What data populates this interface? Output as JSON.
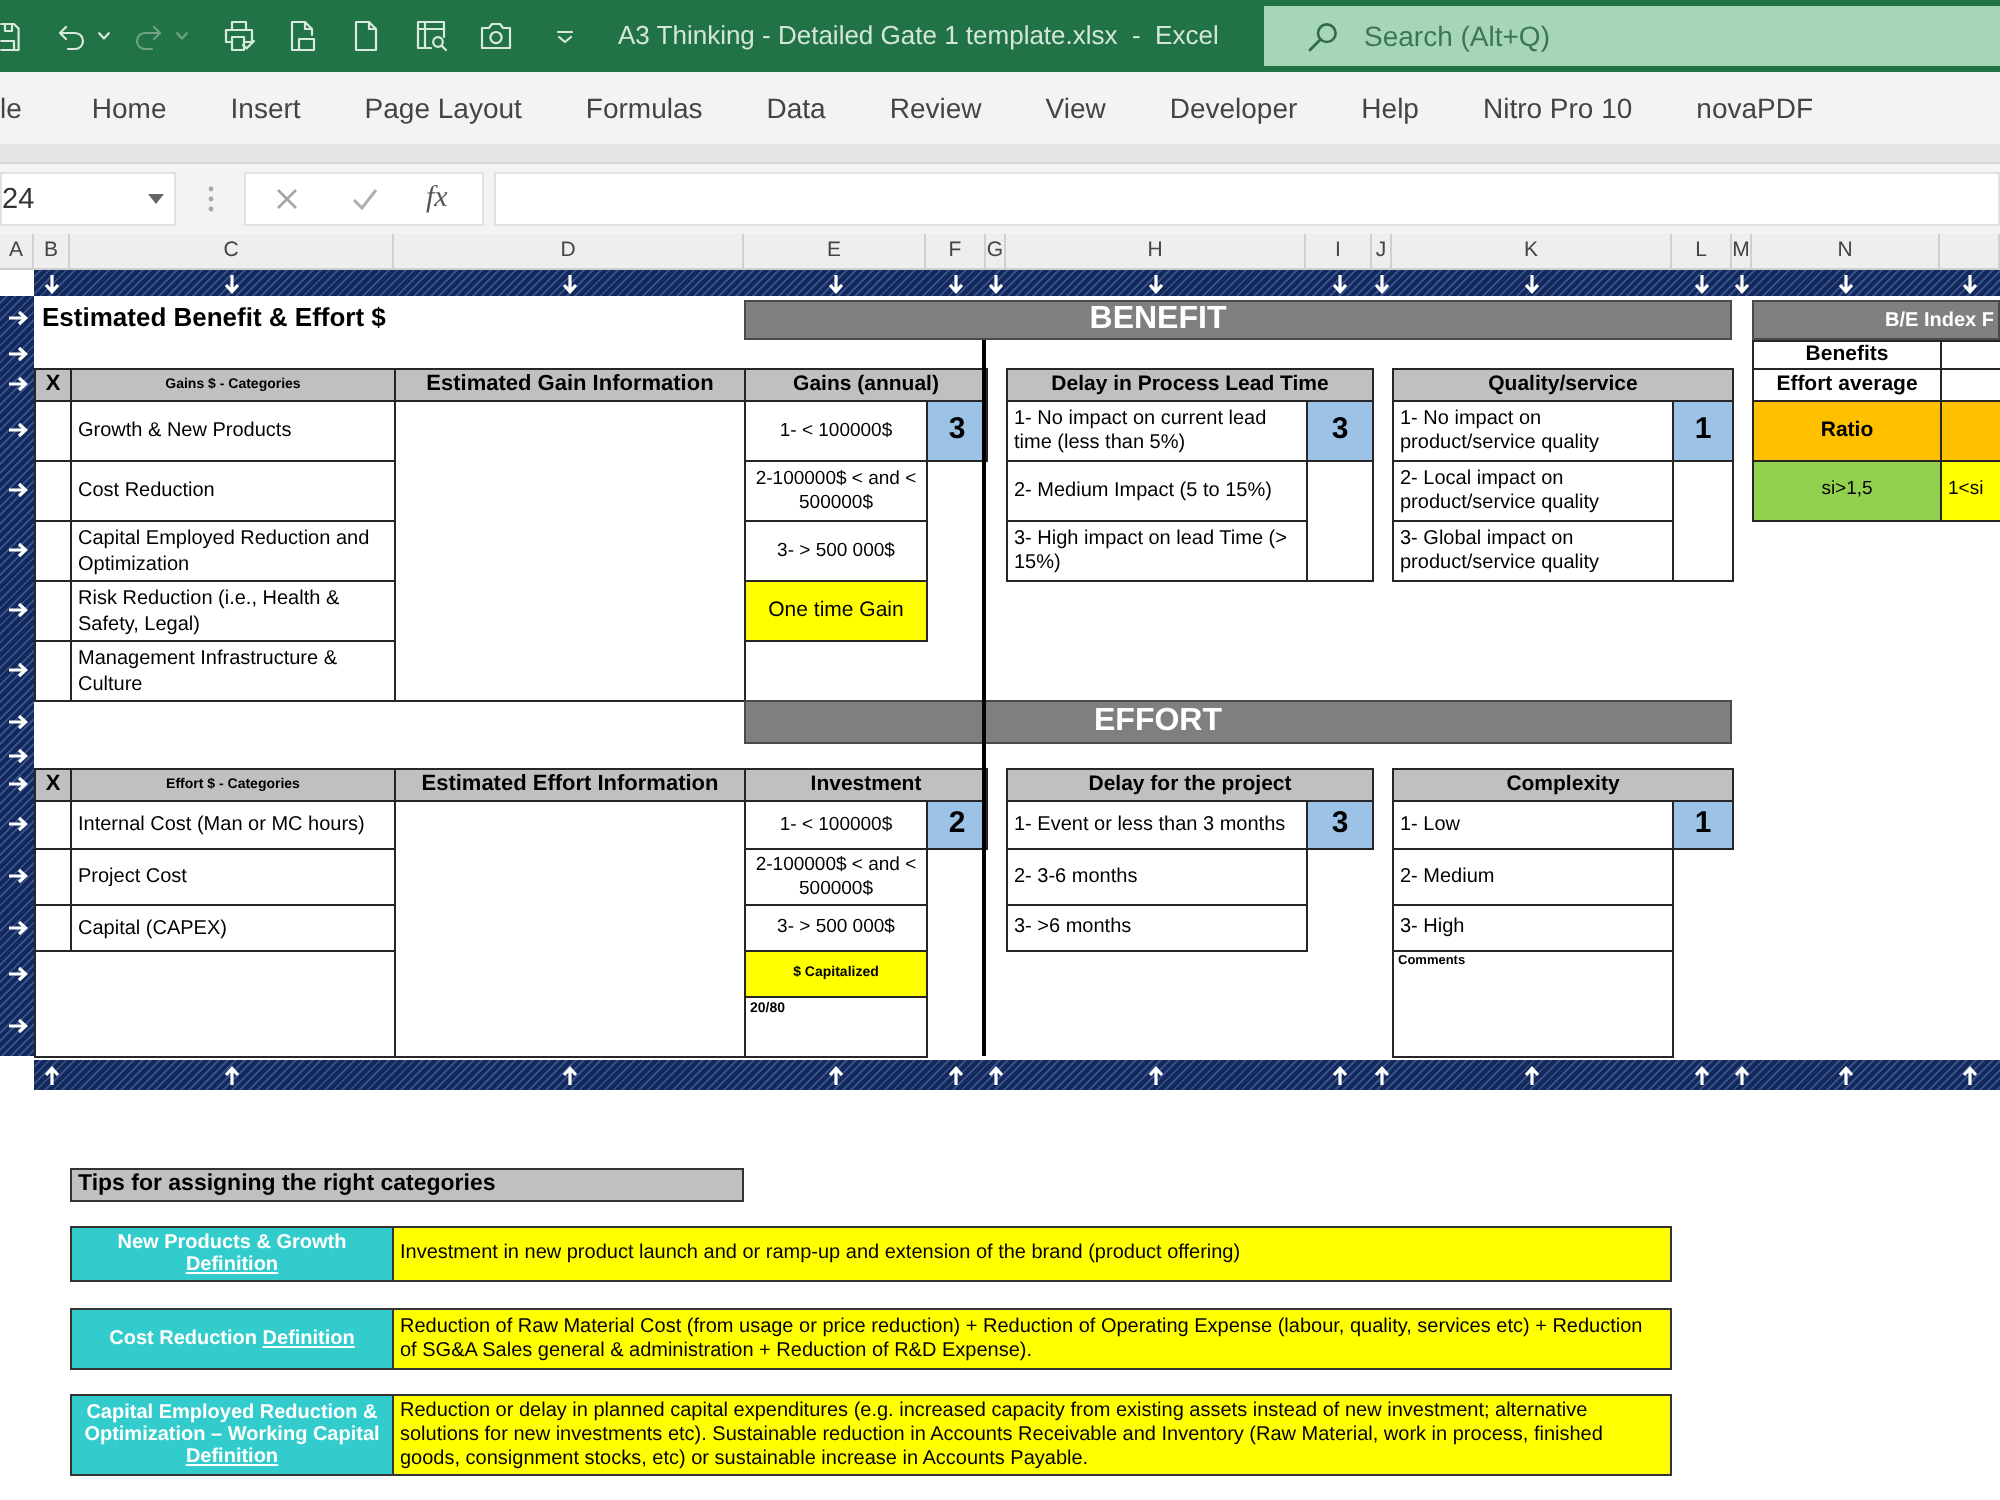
{
  "title_bar": {
    "title": "A3 Thinking - Detailed Gate 1 template.xlsx  -  Excel",
    "search_placeholder": "Search (Alt+Q)"
  },
  "ribbon_tabs": [
    "le",
    "Home",
    "Insert",
    "Page Layout",
    "Formulas",
    "Data",
    "Review",
    "View",
    "Developer",
    "Help",
    "Nitro Pro 10",
    "novaPDF"
  ],
  "formula_bar": {
    "name_box": "24",
    "function_label": "fx"
  },
  "column_headers": [
    "A",
    "B",
    "C",
    "D",
    "E",
    "F",
    "G",
    "H",
    "I",
    "J",
    "K",
    "L",
    "M",
    "N"
  ],
  "sheet": {
    "title": "Estimated Benefit & Effort $",
    "benefit": {
      "banner": "BENEFIT",
      "categories_table": {
        "columns": [
          "X",
          "Gains $ - Categories",
          "Estimated Gain Information",
          "Gains (annual)"
        ],
        "rows": [
          "Growth & New Products",
          "Cost Reduction",
          "Capital Employed Reduction and Optimization",
          "Risk Reduction (i.e., Health & Safety, Legal)",
          "Management Infrastructure & Culture"
        ],
        "options": [
          "1- < 100000$",
          "2-100000$ < and < 500000$",
          "3- > 500 000$"
        ],
        "highlight": "One time Gain",
        "score": "3"
      },
      "criteria": [
        {
          "title": "Delay in Process Lead Time",
          "options": [
            "1- No impact on current lead time (less than 5%)",
            "2- Medium Impact (5 to 15%)",
            "3- High impact on lead Time (> 15%)"
          ],
          "score": "3"
        },
        {
          "title": "Quality/service",
          "options": [
            "1- No impact on product/service quality",
            "2- Local impact on product/service quality",
            "3- Global impact on product/service quality"
          ],
          "score": "1"
        }
      ]
    },
    "effort": {
      "banner": "EFFORT",
      "categories_table": {
        "columns": [
          "X",
          "Effort $ - Categories",
          "Estimated Effort Information",
          "Investment"
        ],
        "rows": [
          "Internal Cost (Man or MC hours)",
          "Project Cost",
          "Capital (CAPEX)"
        ],
        "options": [
          "1- < 100000$",
          "2-100000$ < and < 500000$",
          "3- > 500 000$"
        ],
        "highlight": "$ Capitalized",
        "note": "20/80",
        "score": "2"
      },
      "criteria": [
        {
          "title": "Delay for the project",
          "options": [
            "1- Event or less than 3 months",
            "2- 3-6 months",
            "3- >6 months"
          ],
          "score": "3"
        },
        {
          "title": "Complexity",
          "options": [
            "1- Low",
            "2- Medium",
            "3- High"
          ],
          "comment_label": "Comments",
          "score": "1"
        }
      ]
    },
    "be_index": {
      "title": "B/E Index F",
      "rows": [
        "Benefits",
        "Effort average"
      ],
      "ratio_label": "Ratio",
      "thresholds": [
        {
          "label": "si>1,5",
          "color": "#92d050"
        },
        {
          "label": "1<si",
          "color": "#ffff00"
        }
      ]
    }
  },
  "tips": {
    "title": "Tips for assigning the right categories",
    "definitions": [
      {
        "term": "New Products & Growth",
        "link": "Definition",
        "text": "Investment in new product launch and or ramp-up and extension of the brand (product offering)"
      },
      {
        "term": "Cost Reduction",
        "link": "Definition",
        "text": "Reduction of Raw Material Cost (from usage or price reduction) + Reduction of Operating Expense (labour, quality, services etc) + Reduction of SG&A Sales general & administration + Reduction of R&D Expense)."
      },
      {
        "term": "Capital Employed Reduction & Optimization – Working Capital",
        "link": "Definition",
        "text": "Reduction or delay in planned capital expenditures (e.g. increased capacity from existing assets instead of new investment; alternative solutions for new investments etc). Sustainable reduction in Accounts Receivable and Inventory (Raw Material, work in process, finished goods, consignment stocks, etc) or sustainable increase in Accounts Payable."
      }
    ]
  }
}
